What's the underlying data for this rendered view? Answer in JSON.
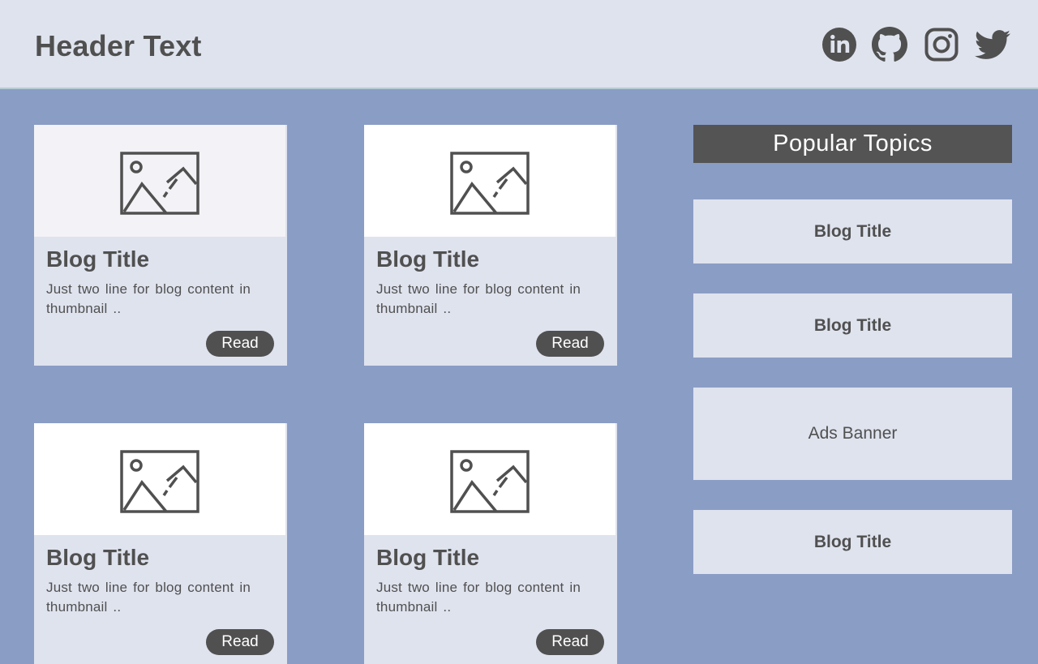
{
  "header": {
    "title": "Header Text"
  },
  "social": [
    {
      "icon": "linkedin-icon"
    },
    {
      "icon": "github-icon"
    },
    {
      "icon": "instagram-icon"
    },
    {
      "icon": "twitter-icon"
    }
  ],
  "posts": [
    {
      "title": "Blog Title",
      "excerpt": "Just two line for blog  content  in thumbnail ..",
      "read_label": "Read"
    },
    {
      "title": "Blog Title",
      "excerpt": "Just two line for blog  content  in thumbnail ..",
      "read_label": "Read"
    },
    {
      "title": "Blog Title",
      "excerpt": "Just two line for blog  content  in thumbnail ..",
      "read_label": "Read"
    },
    {
      "title": "Blog Title",
      "excerpt": "Just two line for blog  content  in thumbnail ..",
      "read_label": "Read"
    }
  ],
  "sidebar": {
    "heading": "Popular Topics",
    "topic_1": "Blog Title",
    "topic_2": "Blog Title",
    "ad": "Ads Banner",
    "topic_3": "Blog Title"
  },
  "colors": {
    "page_bg": "#8a9dc5",
    "header_bg": "#dfe3ee",
    "card_bg": "#dfe3ee",
    "dark": "#505050",
    "heading_bg": "#545454"
  }
}
